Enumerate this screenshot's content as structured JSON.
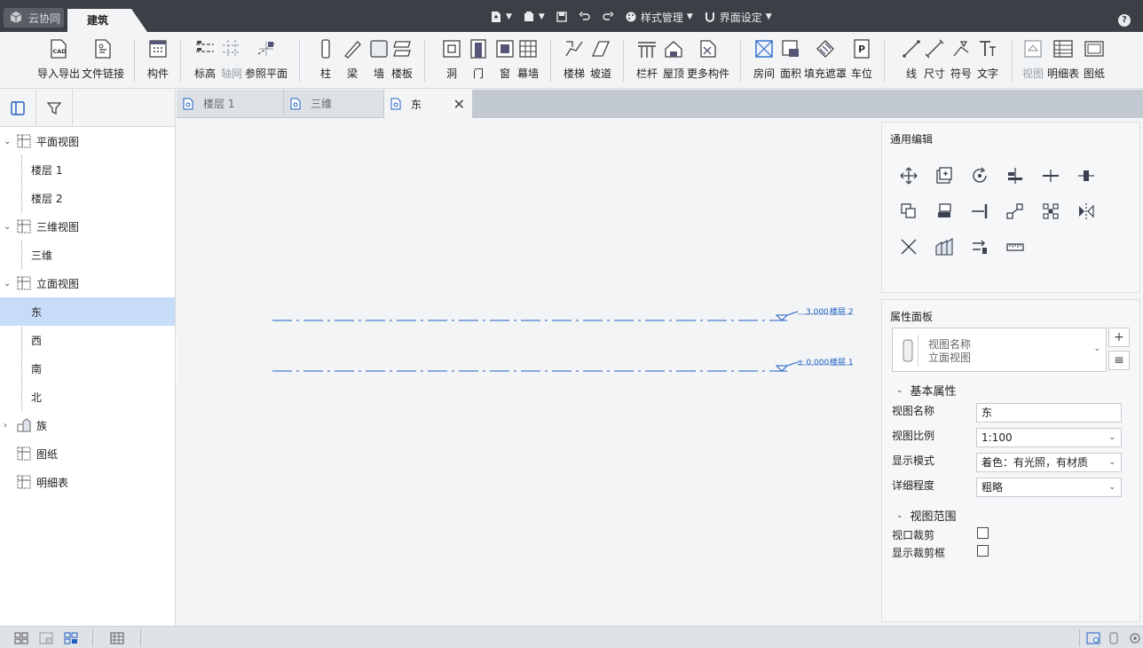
{
  "titlebar": {
    "cloud_label": "云协同",
    "active_tab": "建筑",
    "style_manage": "样式管理",
    "ui_settings": "界面设定"
  },
  "ribbon": {
    "import_export": "导入导出",
    "file_link": "文件链接",
    "component": "构件",
    "level": "标高",
    "grid": "轴网",
    "ref_plane": "参照平面",
    "column": "柱",
    "beam": "梁",
    "wall": "墙",
    "floor": "楼板",
    "opening": "洞",
    "door": "门",
    "window": "窗",
    "curtain_wall": "幕墙",
    "stair": "楼梯",
    "ramp": "坡道",
    "railing": "栏杆",
    "roof": "屋顶",
    "more_components": "更多构件",
    "room": "房间",
    "area": "面积",
    "fill_mask": "填充遮罩",
    "parking": "车位",
    "line": "线",
    "dimension": "尺寸",
    "symbol": "符号",
    "text": "文字",
    "view": "视图",
    "schedule": "明细表",
    "sheet": "图纸"
  },
  "tree": {
    "plan_views": "平面视图",
    "floor1": "楼层 1",
    "floor2": "楼层 2",
    "views_3d": "三维视图",
    "view_3d": "三维",
    "elevation_views": "立面视图",
    "east": "东",
    "west": "西",
    "south": "南",
    "north": "北",
    "family": "族",
    "sheets": "图纸",
    "schedules": "明细表"
  },
  "doc_tabs": [
    "楼层 1",
    "三维",
    "东"
  ],
  "canvas": {
    "level2_value": "3.000",
    "level2_name": "楼层 2",
    "level1_value": "± 0.000",
    "level1_name": "楼层 1"
  },
  "edit_panel": {
    "title": "通用编辑"
  },
  "props": {
    "title": "属性面板",
    "type_line1": "视图名称",
    "type_line2": "立面视图",
    "basic_section": "基本属性",
    "view_name_label": "视图名称",
    "view_name_value": "东",
    "scale_label": "视图比例",
    "scale_value": "1:100",
    "display_label": "显示模式",
    "display_value": "着色：有光照，有材质",
    "detail_label": "详细程度",
    "detail_value": "粗略",
    "range_section": "视图范围",
    "crop_label": "视口裁剪",
    "show_crop_label": "显示裁剪框"
  },
  "colors": {
    "titlebar": "#3c4046",
    "selection": "#c6dcf7",
    "level_line": "#1f5fc4"
  }
}
